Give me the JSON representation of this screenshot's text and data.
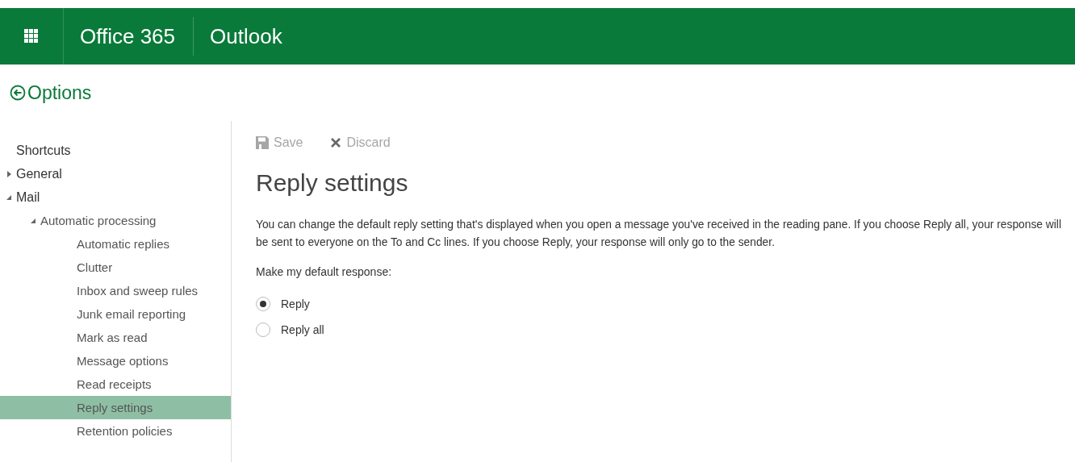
{
  "header": {
    "suite": "Office 365",
    "app": "Outlook"
  },
  "page_title": "Options",
  "sidebar": {
    "items": [
      {
        "label": "Shortcuts",
        "selected": false
      },
      {
        "label": "General",
        "expanded": false
      },
      {
        "label": "Mail",
        "expanded": true,
        "children": [
          {
            "label": "Automatic processing",
            "expanded": true,
            "children": [
              {
                "label": "Automatic replies",
                "selected": false
              },
              {
                "label": "Clutter",
                "selected": false
              },
              {
                "label": "Inbox and sweep rules",
                "selected": false
              },
              {
                "label": "Junk email reporting",
                "selected": false
              },
              {
                "label": "Mark as read",
                "selected": false
              },
              {
                "label": "Message options",
                "selected": false
              },
              {
                "label": "Read receipts",
                "selected": false
              },
              {
                "label": "Reply settings",
                "selected": true
              },
              {
                "label": "Retention policies",
                "selected": false
              }
            ]
          }
        ]
      }
    ]
  },
  "toolbar": {
    "save": {
      "label": "Save",
      "disabled": true
    },
    "discard": {
      "label": "Discard",
      "disabled": true
    }
  },
  "heading": "Reply settings",
  "description": "You can change the default reply setting that's displayed when you open a message you've received in the reading pane. If you choose Reply all, your response will be sent to everyone on the To and Cc lines. If you choose Reply, your response will only go to the sender.",
  "prompt": "Make my default response:",
  "options": [
    {
      "label": "Reply",
      "selected": true
    },
    {
      "label": "Reply all",
      "selected": false
    }
  ]
}
